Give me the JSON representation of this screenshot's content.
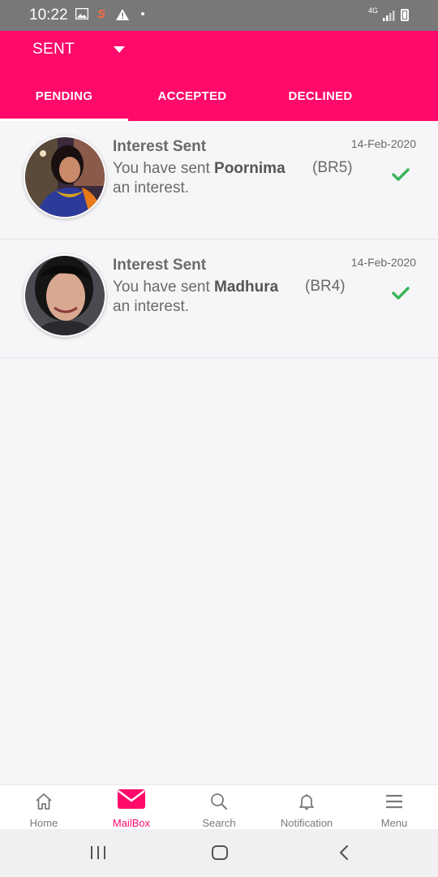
{
  "status_bar": {
    "time": "10:22",
    "network": "4G"
  },
  "header": {
    "dropdown_label": "SENT",
    "tabs": [
      {
        "label": "PENDING",
        "active": true
      },
      {
        "label": "ACCEPTED",
        "active": false
      },
      {
        "label": "DECLINED",
        "active": false
      }
    ],
    "accent_color": "#ff0a6b"
  },
  "items": [
    {
      "title": "Interest Sent",
      "text_before": "You have sent",
      "name": "Poornima",
      "id": "(BR5)",
      "text_after": "an interest.",
      "date": "14-Feb-2020",
      "icon": "check-icon"
    },
    {
      "title": "Interest Sent",
      "text_before": "You have sent",
      "name": "Madhura",
      "id": "(BR4)",
      "text_after": "an interest.",
      "date": "14-Feb-2020",
      "icon": "check-icon"
    }
  ],
  "bottom_nav": [
    {
      "label": "Home",
      "icon": "home-icon"
    },
    {
      "label": "MailBox",
      "icon": "mail-icon",
      "active": true
    },
    {
      "label": "Search",
      "icon": "search-icon"
    },
    {
      "label": "Notification",
      "icon": "bell-icon"
    },
    {
      "label": "Menu",
      "icon": "menu-icon"
    }
  ]
}
